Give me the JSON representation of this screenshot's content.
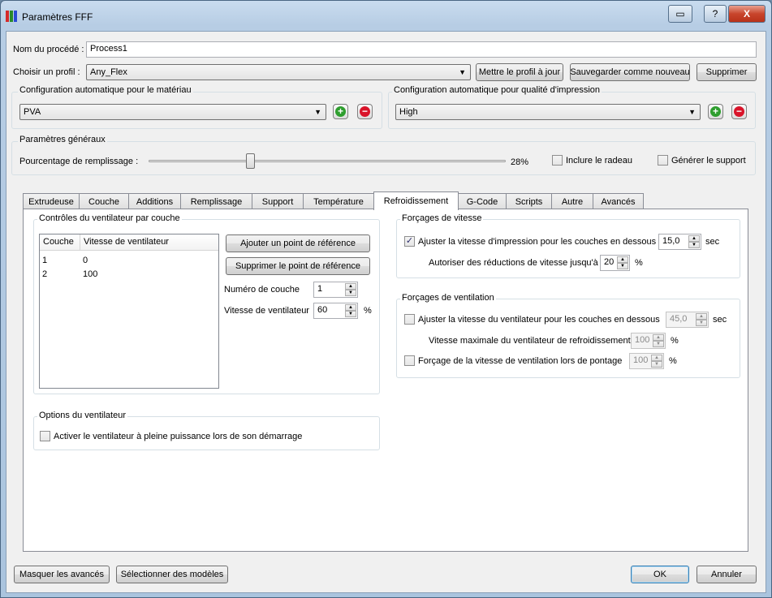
{
  "window": {
    "title": "Paramètres FFF",
    "controls": [
      "▭",
      "?",
      "X"
    ]
  },
  "process": {
    "name_label": "Nom du procédé :",
    "name_value": "Process1"
  },
  "profile": {
    "label": "Choisir un profil :",
    "value": "Any_Flex",
    "update_button": "Mettre le profil à jour",
    "save_new_button": "Sauvegarder comme nouveau",
    "delete_button": "Supprimer"
  },
  "material_config": {
    "title": "Configuration automatique pour le matériau",
    "value": "PVA"
  },
  "quality_config": {
    "title": "Configuration automatique pour qualité d'impression",
    "value": "High"
  },
  "general": {
    "title": "Paramètres généraux",
    "infill_label": "Pourcentage de remplissage :",
    "infill_value": "28%",
    "infill_percent": 28,
    "raft_label": "Inclure le radeau",
    "support_label": "Générer le support"
  },
  "tabs": [
    {
      "label": "Extrudeuse"
    },
    {
      "label": "Couche"
    },
    {
      "label": "Additions"
    },
    {
      "label": "Remplissage"
    },
    {
      "label": "Support"
    },
    {
      "label": "Température"
    },
    {
      "label": "Refroidissement"
    },
    {
      "label": "G-Code"
    },
    {
      "label": "Scripts"
    },
    {
      "label": "Autre"
    },
    {
      "label": "Avancés"
    }
  ],
  "fan_layers": {
    "title": "Contrôles du ventilateur par couche",
    "columns": [
      "Couche",
      "Vitesse de ventilateur"
    ],
    "rows": [
      [
        "1",
        "0"
      ],
      [
        "2",
        "100"
      ]
    ],
    "add_button": "Ajouter un point de référence",
    "remove_button": "Supprimer le point de référence",
    "layer_label": "Numéro de couche",
    "layer_value": "1",
    "speed_label": "Vitesse de ventilateur",
    "speed_value": "60",
    "speed_unit": "%"
  },
  "fan_options": {
    "title": "Options du ventilateur",
    "full_power_label": "Activer le ventilateur à pleine puissance lors de son démarrage"
  },
  "speed_overrides": {
    "title": "Forçages de vitesse",
    "adjust_label": "Ajuster la vitesse d'impression pour les couches en dessous",
    "adjust_value": "15,0",
    "adjust_unit": "sec",
    "allow_label": "Autoriser des réductions de vitesse jusqu'à",
    "allow_value": "20",
    "allow_unit": "%"
  },
  "fan_overrides": {
    "title": "Forçages de ventilation",
    "adjust_label": "Ajuster la vitesse du ventilateur pour les couches en dessous",
    "adjust_value": "45,0",
    "adjust_unit": "sec",
    "max_label": "Vitesse maximale du ventilateur de refroidissement",
    "max_value": "100",
    "max_unit": "%",
    "bridge_label": "Forçage de la vitesse de ventilation lors de pontage",
    "bridge_value": "100",
    "bridge_unit": "%"
  },
  "footer": {
    "hide_advanced_button": "Masquer les avancés",
    "select_models_button": "Sélectionner des modèles",
    "ok_button": "OK",
    "cancel_button": "Annuler"
  },
  "colors": {
    "add": "#2e9e2e",
    "remove": "#d9142a",
    "focus": "#3c7fb1"
  }
}
